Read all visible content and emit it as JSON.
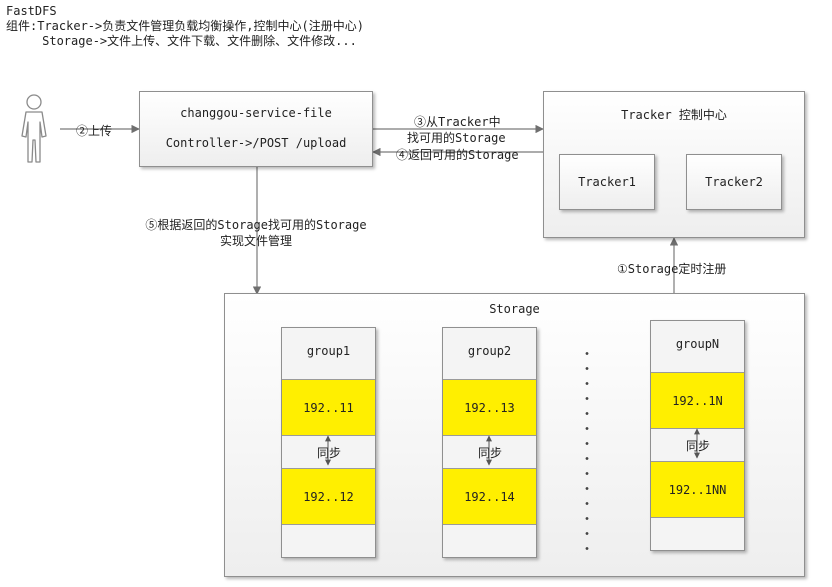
{
  "header": {
    "title": "FastDFS",
    "line1": "组件:Tracker->负责文件管理负载均衡操作,控制中心(注册中心)",
    "line2": "     Storage->文件上传、文件下载、文件删除、文件修改..."
  },
  "service": {
    "name": "changgou-service-file",
    "endpoint": "Controller->/POST /upload"
  },
  "tracker": {
    "title": "Tracker  控制中心",
    "node1": "Tracker1",
    "node2": "Tracker2"
  },
  "storage": {
    "title": "Storage",
    "groups": [
      {
        "name": "group1",
        "ip1": "192..11",
        "ip2": "192..12",
        "sync": "同步"
      },
      {
        "name": "group2",
        "ip1": "192..13",
        "ip2": "192..14",
        "sync": "同步"
      },
      {
        "name": "groupN",
        "ip1": "192..1N",
        "ip2": "192..1NN",
        "sync": "同步"
      }
    ]
  },
  "arrows": {
    "upload": "②上传",
    "find_storage_1": "③从Tracker中",
    "find_storage_2": "找可用的Storage",
    "return_storage": "④返回可用的Storage",
    "manage_1": "⑤根据返回的Storage找可用的Storage",
    "manage_2": "实现文件管理",
    "register": "①Storage定时注册"
  }
}
